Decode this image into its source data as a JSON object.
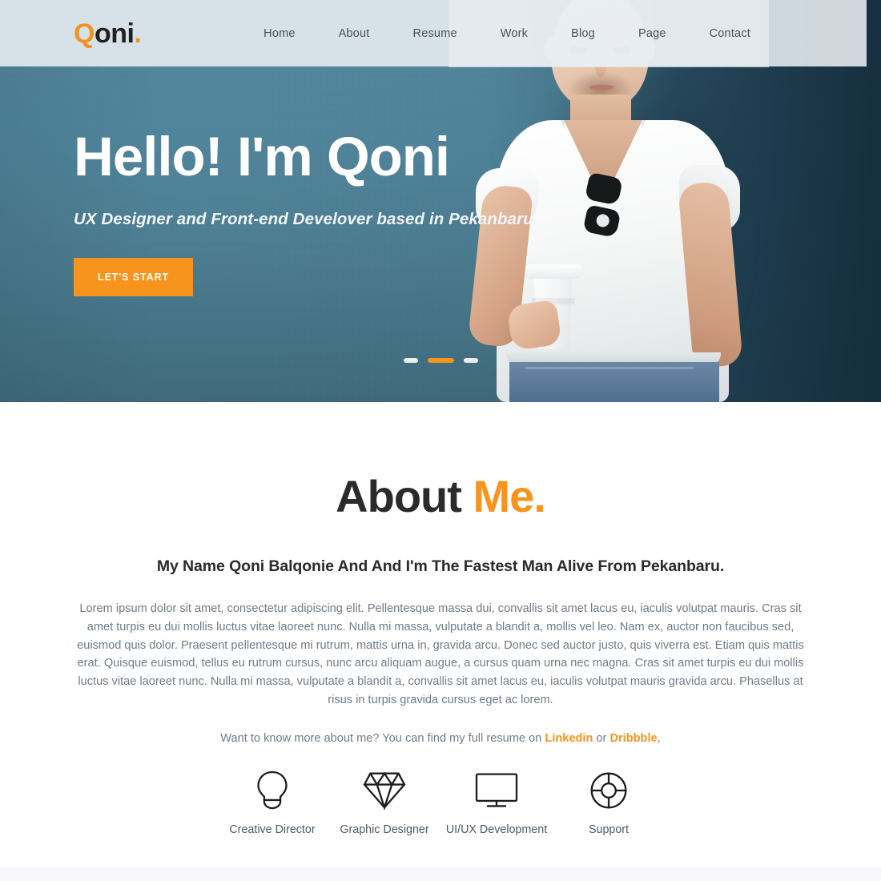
{
  "brand": {
    "logo_q": "Q",
    "logo_rest": "oni",
    "logo_dot": ".",
    "accent_color": "#f7941d",
    "hero_bg_color": "#4a8099"
  },
  "nav": {
    "items": [
      {
        "label": "Home"
      },
      {
        "label": "About"
      },
      {
        "label": "Resume"
      },
      {
        "label": "Work"
      },
      {
        "label": "Blog"
      },
      {
        "label": "Page"
      },
      {
        "label": "Contact"
      }
    ]
  },
  "hero": {
    "title": "Hello! I'm Qoni",
    "subtitle": "UX Designer and Front-end Develover based in Pekanbaru.",
    "cta_label": "LET'S START",
    "slider": {
      "total": 3,
      "active_index": 1
    }
  },
  "about": {
    "title_main": "About ",
    "title_accent": "Me.",
    "subtitle": "My Name Qoni Balqonie And And I'm The Fastest Man Alive From Pekanbaru.",
    "body": "Lorem ipsum dolor sit amet, consectetur adipiscing elit. Pellentesque massa dui, convallis sit amet lacus eu, iaculis volutpat mauris. Cras sit amet turpis eu dui mollis luctus vitae laoreet nunc. Nulla mi massa, vulputate a blandit a, mollis vel leo. Nam ex, auctor non faucibus sed, euismod quis dolor. Praesent pellentesque mi rutrum, mattis urna in, gravida arcu. Donec sed auctor justo, quis viverra est. Etiam quis mattis erat. Quisque euismod, tellus eu rutrum cursus, nunc arcu aliquam augue, a cursus quam urna nec magna. Cras sit amet turpis eu dui mollis luctus vitae laoreet nunc. Nulla mi massa, vulputate a blandit a, convallis sit amet lacus eu, iaculis volutpat mauris gravida arcu. Phasellus at risus in turpis gravida cursus eget ac lorem.",
    "links_prefix": "Want to know more about me? You can find my full resume on ",
    "link_one": "Linkedin",
    "links_join": " or ",
    "link_two": "Dribbble",
    "links_suffix": ","
  },
  "services": [
    {
      "icon": "lightbulb-icon",
      "label": "Creative Director"
    },
    {
      "icon": "diamond-icon",
      "label": "Graphic Designer"
    },
    {
      "icon": "monitor-icon",
      "label": "UI/UX Development"
    },
    {
      "icon": "lifebuoy-icon",
      "label": "Support"
    }
  ]
}
